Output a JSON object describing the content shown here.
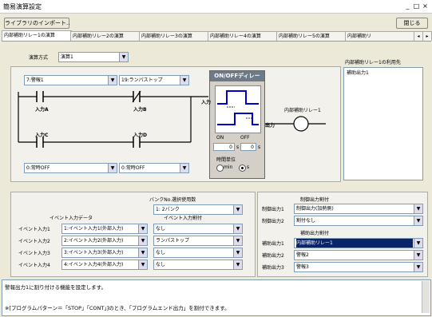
{
  "window": {
    "title": "簡易演算設定",
    "controls": [
      "_",
      "□",
      "×"
    ]
  },
  "toolbar": {
    "import_label": "ライブラリのインポート..",
    "close_label": "閉じる"
  },
  "tabs": [
    "内部補助リレー1の演算",
    "内部補助リレー2の演算",
    "内部補助リレー3の演算",
    "内部補助リレー4の演算",
    "内部補助リレー5の演算",
    "内部補助リ"
  ],
  "tab_scroll": [
    "◂",
    "▸"
  ],
  "method": {
    "label": "演算方式",
    "value": "演算1"
  },
  "ladder": {
    "input_a_select": "7:警報1",
    "input_b_select": "19:ランパストップ",
    "input_a": "入力A",
    "input_b": "入力B",
    "input_c": "入力C",
    "input_d": "入力D",
    "input_c_select": "0:常時OFF",
    "input_d_select": "0:常時OFF",
    "output_relay": "内部補助リレー1"
  },
  "delay": {
    "title": "ON/OFFディレー",
    "input": "入力",
    "output": "出力",
    "on_label": "ON",
    "off_label": "OFF",
    "on_value": "0",
    "off_value": "0",
    "unit_label": "s",
    "time_unit_label": "時間単位",
    "min_label": "min",
    "s_label": "s"
  },
  "usage": {
    "title": "内部補助リレー1の利用先",
    "items": [
      "補助出力1"
    ]
  },
  "bank": {
    "label": "バンクNo.選択使用数",
    "value": "1: 2バンク"
  },
  "event_input_data_label": "イベント入力データ",
  "event_input_assign_label": "イベント入力割付",
  "events": [
    {
      "label": "イベント入力1",
      "data": "1:イベント入力1(外部入力)",
      "assign": "なし"
    },
    {
      "label": "イベント入力2",
      "data": "2:イベント入力2(外部入力)",
      "assign": "ランパストップ"
    },
    {
      "label": "イベント入力3",
      "data": "3:イベント入力3(外部入力)",
      "assign": "なし"
    },
    {
      "label": "イベント入力4",
      "data": "4:イベント入力4(外部入力)",
      "assign": "なし"
    }
  ],
  "control_output": {
    "title": "制御出力割付",
    "rows": [
      {
        "label": "制御出力1",
        "value": "制御出力(加熱側)"
      },
      {
        "label": "制御出力2",
        "value": "割付なし"
      }
    ]
  },
  "aux_output": {
    "title": "補助出力割付",
    "rows": [
      {
        "label": "補助出力1",
        "value": "内部補助リレー1"
      },
      {
        "label": "補助出力2",
        "value": "警報2"
      },
      {
        "label": "補助出力3",
        "value": "警報3"
      }
    ]
  },
  "footer": {
    "line1": "警報出力1に割り付ける機能を設定します。",
    "line2": "※[プログラムパターン＝「STOP」「CONT」]のとき、「プログラムエンド出力」を割付できます。"
  },
  "colors": {
    "selection": "#0a246a",
    "accent": "#0000cc",
    "panel": "#ece9d8"
  }
}
